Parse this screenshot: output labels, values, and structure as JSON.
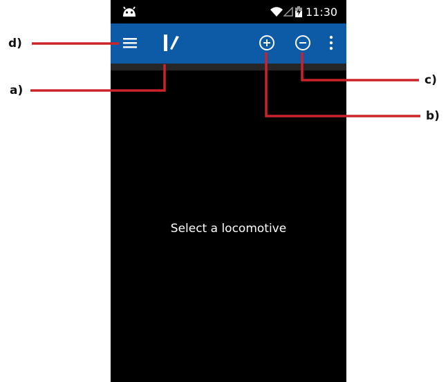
{
  "status_bar": {
    "time": "11:30",
    "icons": [
      "android-icon",
      "wifi-icon",
      "signal-icon",
      "battery-charging-icon"
    ]
  },
  "toolbar": {
    "color": "#0d5aa7",
    "icons": [
      "menu-icon",
      "app-logo-icon",
      "add-circle-icon",
      "remove-circle-icon",
      "overflow-menu-icon"
    ]
  },
  "main": {
    "empty_message": "Select a locomotive"
  },
  "annotations": {
    "color": "#cc2229",
    "labels": {
      "a": "a)",
      "b": "b)",
      "c": "c)",
      "d": "d)"
    }
  }
}
